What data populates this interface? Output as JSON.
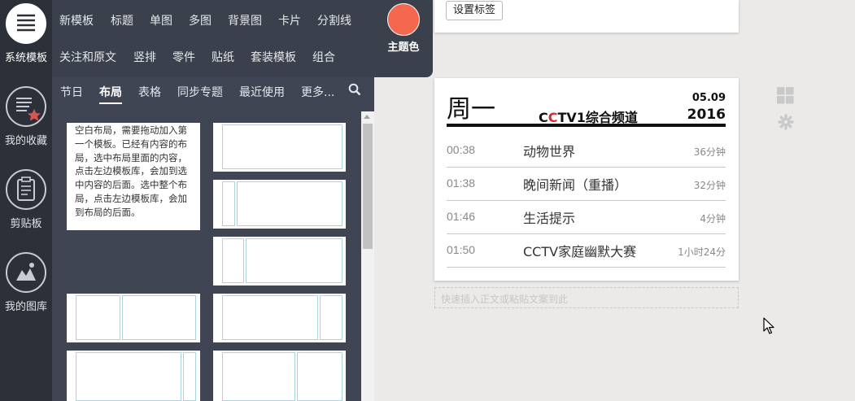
{
  "sidebar": {
    "system_template": "系统模板",
    "favorites": "我的收藏",
    "clipboard": "剪贴板",
    "gallery": "我的图库"
  },
  "categories_row1": [
    "新模板",
    "标题",
    "单图",
    "多图",
    "背景图",
    "卡片",
    "分割线"
  ],
  "categories_row2": [
    "关注和原文",
    "竖排",
    "零件",
    "贴纸",
    "套装模板",
    "组合"
  ],
  "theme": {
    "label": "主题色",
    "color": "#f4684f"
  },
  "subtabs": [
    "节日",
    "布局",
    "表格",
    "同步专题",
    "最近使用",
    "更多..."
  ],
  "active_subtab": "布局",
  "layout_description": "空白布局，需要拖动加入第一个模板。已经有内容的布局，选中布局里面的内容，点击左边模板库，会加到选中内容的后面。选中整个布局，点击左边模板库，会加到布局的后面。",
  "editor": {
    "set_tag_button": "设置标签",
    "weekday": "周一",
    "channel_c1": "C",
    "channel_c2": "C",
    "channel_rest": "TV1综合频道",
    "date_md": "05.09",
    "date_year": "2016",
    "programs": [
      {
        "time": "00:38",
        "name": "动物世界",
        "duration": "36分钟"
      },
      {
        "time": "01:38",
        "name": "晚间新闻（重播）",
        "duration": "32分钟"
      },
      {
        "time": "01:46",
        "name": "生活提示",
        "duration": "4分钟"
      },
      {
        "time": "01:50",
        "name": "CCTV家庭幽默大赛",
        "duration": "1小时24分"
      }
    ],
    "paste_placeholder": "快速插入正文或粘贴文案到此"
  }
}
